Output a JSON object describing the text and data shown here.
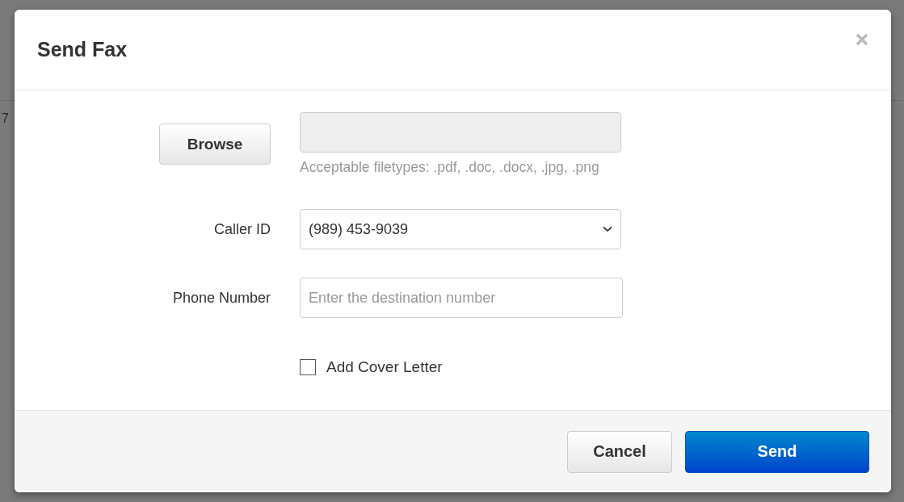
{
  "background": {
    "cell_text": "7"
  },
  "dialog": {
    "title": "Send Fax",
    "file": {
      "button": "Browse",
      "hint": "Acceptable filetypes: .pdf, .doc, .docx, .jpg, .png"
    },
    "caller_id": {
      "label": "Caller ID",
      "value": "(989) 453-9039"
    },
    "phone_number": {
      "label": "Phone Number",
      "placeholder": "Enter the destination number"
    },
    "cover_letter": {
      "label": "Add Cover Letter",
      "checked": false
    },
    "buttons": [
      {
        "label": "Cancel",
        "kind": "secondary"
      },
      {
        "label": "Send",
        "kind": "primary"
      }
    ]
  }
}
